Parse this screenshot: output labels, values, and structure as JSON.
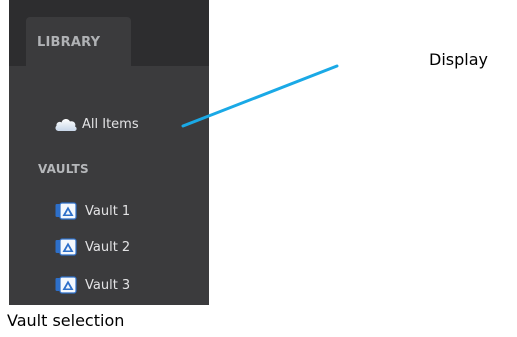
{
  "sidebar": {
    "tab_label": "LIBRARY",
    "all_items": {
      "label": "All Items",
      "icon": "cloud-icon"
    },
    "vaults_heading": "VAULTS",
    "vaults": [
      {
        "label": "Vault 1",
        "icon": "vault-icon"
      },
      {
        "label": "Vault 2",
        "icon": "vault-icon"
      },
      {
        "label": "Vault 3",
        "icon": "vault-icon"
      }
    ]
  },
  "annotations": {
    "display_label": "Display",
    "vault_selection_label": "Vault selection",
    "leader_color": "#1aa9e6"
  },
  "colors": {
    "panel_bg": "#3b3b3d",
    "tabbar_bg": "#2d2d2f",
    "vault_icon_blue": "#2d6fc9"
  }
}
